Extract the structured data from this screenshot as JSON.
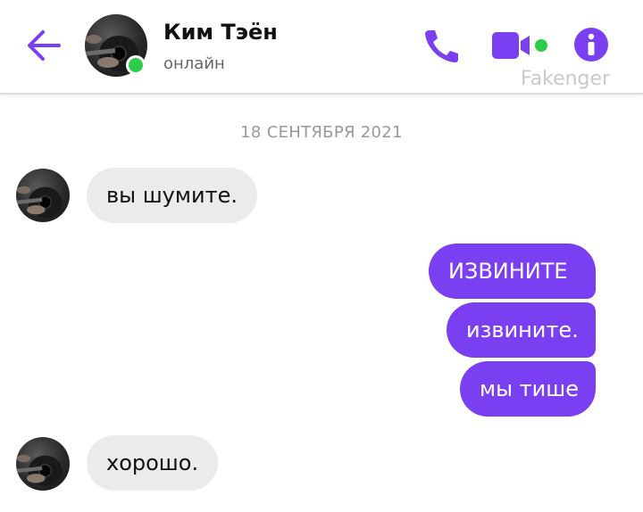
{
  "header": {
    "contact_name": "Ким Тэён",
    "status": "онлайн",
    "watermark": "Fakenger",
    "icons": {
      "back": "back-arrow-icon",
      "call": "phone-icon",
      "video": "video-camera-icon",
      "info": "info-icon"
    },
    "online": true
  },
  "colors": {
    "accent": "#7b3ff2",
    "online": "#2ecc4a",
    "incoming_bubble": "#ebebeb",
    "outgoing_bubble": "#7b3ff2"
  },
  "conversation": {
    "date_separator": "18 СЕНТЯБРЯ 2021",
    "messages": [
      {
        "direction": "incoming",
        "text": "вы шумите."
      },
      {
        "direction": "outgoing",
        "text": "ИЗВИНИТЕ"
      },
      {
        "direction": "outgoing",
        "text": "извините."
      },
      {
        "direction": "outgoing",
        "text": "мы тише"
      },
      {
        "direction": "incoming",
        "text": "хорошо."
      }
    ]
  }
}
